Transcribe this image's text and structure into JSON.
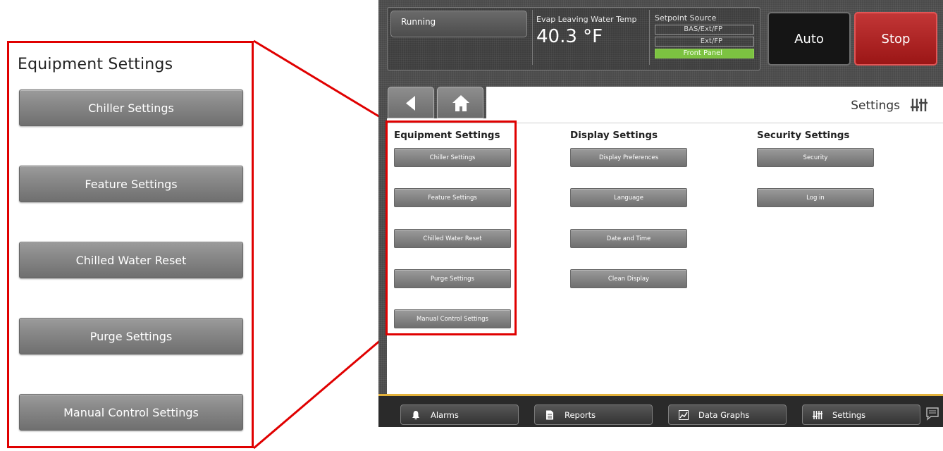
{
  "zoom": {
    "title": "Equipment Settings",
    "buttons": [
      "Chiller Settings",
      "Feature Settings",
      "Chilled Water Reset",
      "Purge Settings",
      "Manual Control Settings"
    ]
  },
  "status": {
    "running": "Running",
    "evap_label": "Evap Leaving Water Temp",
    "evap_value": "40.3 °F",
    "setpoint_label": "Setpoint Source",
    "setpoint_options": [
      "BAS/Ext/FP",
      "Ext/FP",
      "Front Panel"
    ],
    "setpoint_selected": "Front Panel",
    "auto": "Auto",
    "stop": "Stop",
    "colors": {
      "selected": "#7cc241",
      "stop": "#b02020"
    }
  },
  "page": {
    "title": "Settings",
    "columns": [
      {
        "title": "Equipment Settings",
        "buttons": [
          "Chiller Settings",
          "Feature Settings",
          "Chilled Water Reset",
          "Purge Settings",
          "Manual Control Settings"
        ]
      },
      {
        "title": "Display Settings",
        "buttons": [
          "Display Preferences",
          "Language",
          "Date and Time",
          "Clean Display"
        ]
      },
      {
        "title": "Security Settings",
        "buttons": [
          "Security",
          "Log in"
        ]
      }
    ]
  },
  "bottom_tabs": [
    {
      "label": "Alarms",
      "icon": "bell-icon"
    },
    {
      "label": "Reports",
      "icon": "document-icon"
    },
    {
      "label": "Data Graphs",
      "icon": "graph-icon"
    },
    {
      "label": "Settings",
      "icon": "sliders-icon"
    }
  ],
  "highlight_color": "#e00000"
}
